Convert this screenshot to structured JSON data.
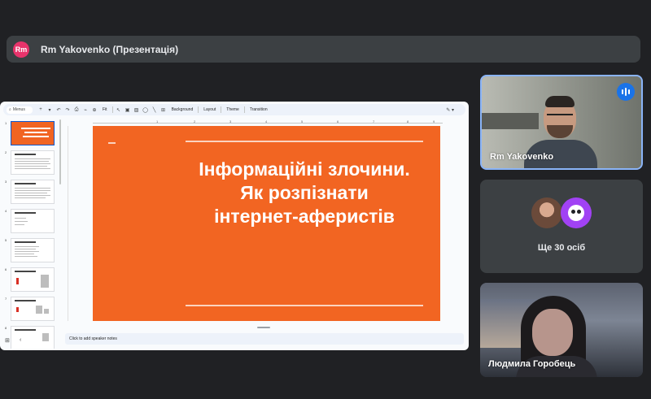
{
  "presenter_bar": {
    "avatar_initials": "Rm",
    "title": "Rm Yakovenko (Презентація)"
  },
  "slides_app": {
    "toolbar": {
      "search_label": "Menus",
      "zoom_label": "Fit",
      "background_label": "Background",
      "layout_label": "Layout",
      "theme_label": "Theme",
      "transition_label": "Transition"
    },
    "ruler_numbers": [
      "1",
      "2",
      "3",
      "4",
      "5",
      "6",
      "7",
      "8",
      "9"
    ],
    "thumbnails": [
      "1",
      "2",
      "3",
      "4",
      "5",
      "6",
      "7",
      "8"
    ],
    "slide": {
      "title_line1": "Інформаційні злочини.",
      "title_line2": "Як розпізнати",
      "title_line3": "інтернет-аферистів"
    },
    "speaker_notes_placeholder": "Click to add speaker notes"
  },
  "participants": {
    "main_camera_name": "Rm Yakovenko",
    "others_label": "Ще 30 осіб",
    "second_camera_name": "Людмила Горобець"
  },
  "colors": {
    "slide_background": "#f26522",
    "active_speaker_border": "#8ab4f8",
    "avatar_color": "#e8336b"
  }
}
